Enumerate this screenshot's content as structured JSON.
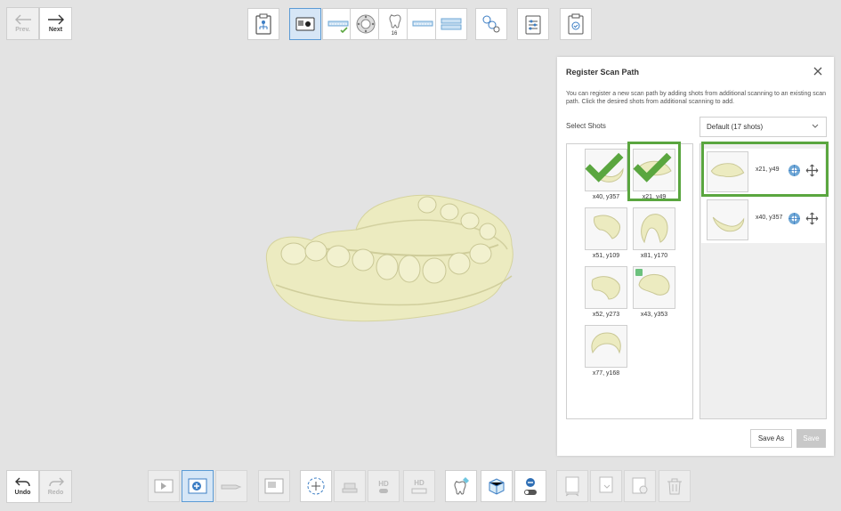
{
  "nav": {
    "prev_label": "Prev.",
    "next_label": "Next"
  },
  "panel": {
    "title": "Register Scan Path",
    "description": "You can register a new scan path by adding shots from additional scanning to an existing scan path. Click the desired shots from additional scanning to add.",
    "select_label": "Select Shots",
    "dropdown_value": "Default (17 shots)",
    "shots": [
      {
        "label": "x40, y357",
        "checked": true
      },
      {
        "label": "x21, y49",
        "checked": true,
        "highlighted": true
      },
      {
        "label": "x51, y109"
      },
      {
        "label": "x81, y170"
      },
      {
        "label": "x52, y273"
      },
      {
        "label": "x43, y353",
        "marked": true
      },
      {
        "label": "x77, y168"
      }
    ],
    "path": [
      {
        "label": "x21, y49",
        "highlighted": true
      },
      {
        "label": "x40, y357"
      }
    ],
    "save_as_label": "Save As",
    "save_label": "Save"
  },
  "toolbar": {
    "count_badge": "16"
  },
  "bottom": {
    "undo_label": "Undo",
    "redo_label": "Redo"
  },
  "colors": {
    "accent_green": "#5aa63f",
    "accent_blue": "#5b9bd5",
    "model": "#ecebc0"
  }
}
